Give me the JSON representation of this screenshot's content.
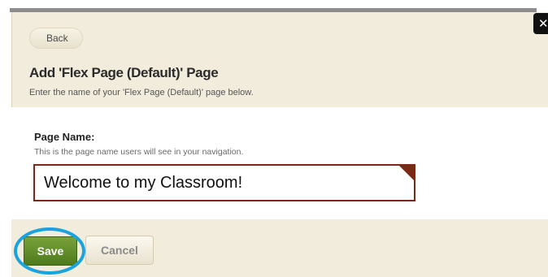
{
  "dialog": {
    "close_glyph": "✕",
    "back_label": "Back",
    "title": "Add 'Flex Page (Default)' Page",
    "subtitle": "Enter the name of your 'Flex Page (Default)' page below."
  },
  "form": {
    "page_name_label": "Page Name:",
    "page_name_help": "This is the page name users will see in your navigation.",
    "page_name_value": "Welcome to my Classroom!"
  },
  "footer": {
    "save_label": "Save",
    "cancel_label": "Cancel"
  },
  "colors": {
    "dialog_bg": "#f1ecdb",
    "input_border": "#7a2a14",
    "save_green": "#5a8a24",
    "highlight_ring": "#1aa3df"
  }
}
